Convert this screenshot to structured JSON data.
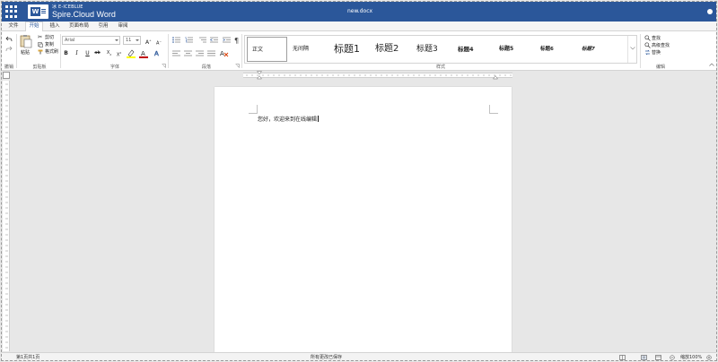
{
  "app": {
    "brand_small": "冰 E-ICEBLUE",
    "brand_name": "Spire.Cloud Word",
    "document_name": "new.docx"
  },
  "tabs": [
    {
      "label": "文件",
      "active": false
    },
    {
      "label": "开始",
      "active": true
    },
    {
      "label": "插入",
      "active": false
    },
    {
      "label": "页面布局",
      "active": false
    },
    {
      "label": "引用",
      "active": false
    },
    {
      "label": "审阅",
      "active": false
    }
  ],
  "ribbon": {
    "undo_group_label": "撤销",
    "clipboard": {
      "paste": "粘贴",
      "cut": "剪切",
      "copy": "复制",
      "format_painter": "格式刷",
      "label": "剪贴板"
    },
    "font": {
      "font_name": "Arial",
      "font_size": "11",
      "grow": "A",
      "shrink": "A",
      "bold": "B",
      "italic": "I",
      "underline": "U",
      "strikethrough": "ab",
      "subscript": "X",
      "superscript": "X",
      "label": "字体"
    },
    "paragraph": {
      "label": "段落"
    },
    "styles": {
      "items": [
        "正文",
        "无间隔",
        "标题1",
        "标题2",
        "标题3",
        "标题4",
        "标题5",
        "标题6",
        "标题7"
      ],
      "label": "样式"
    },
    "editing": {
      "find": "查找",
      "advanced_find": "高级查找",
      "replace": "替换",
      "label": "编辑"
    }
  },
  "colors": {
    "title_bar": "#2b579a",
    "accent": "#2b579a",
    "highlight": "#ffff00",
    "font_color": "#c00000",
    "clear_format": "#d83b01"
  },
  "document": {
    "text": "您好，欢迎来到在线编辑"
  },
  "status": {
    "page_info": "第1页共1页",
    "save_state": "所有更改已保存",
    "zoom": "缩放100%"
  }
}
